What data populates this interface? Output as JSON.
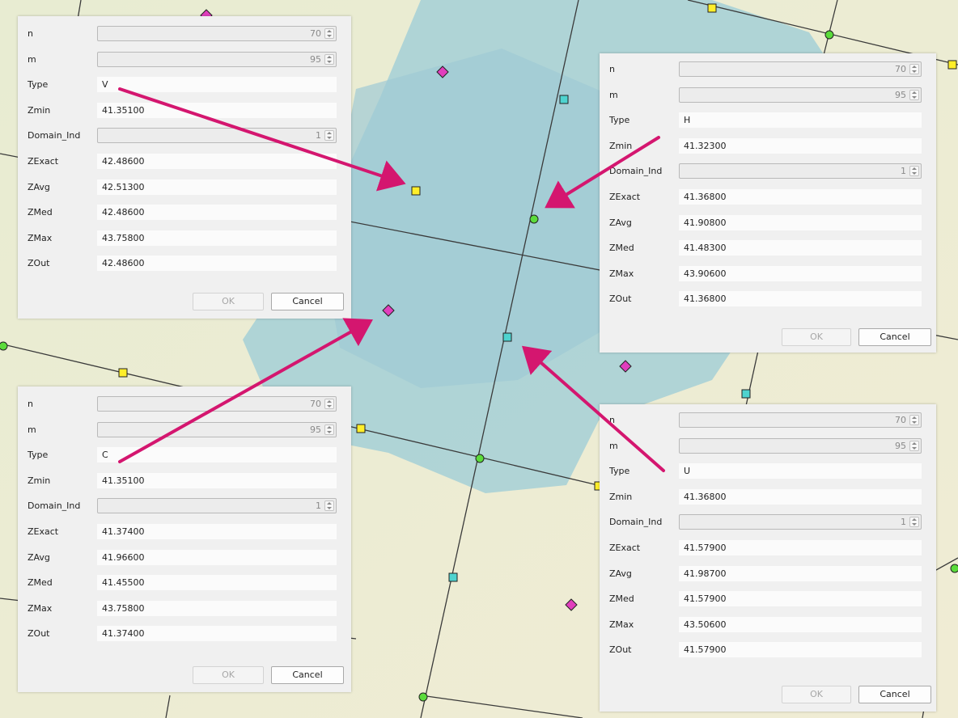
{
  "colors": {
    "arrow": "#d4166f",
    "node_green": "#5bdb3b",
    "node_yellow": "#ffee2a",
    "node_cyan": "#4ed3cf",
    "node_magenta": "#e13fbd",
    "water": "#a9d2d6",
    "land": "#e9ecd6"
  },
  "icons": {
    "spinbox": "spinbox-arrows-icon",
    "arrow": "annotation-arrow-icon",
    "node_markers": [
      "green-circle-node",
      "yellow-square-node",
      "cyan-square-node",
      "magenta-diamond-node"
    ]
  },
  "dialogs": [
    {
      "id": "v",
      "fields": [
        {
          "label": "n",
          "value": "70",
          "kind": "spin"
        },
        {
          "label": "m",
          "value": "95",
          "kind": "spin"
        },
        {
          "label": "Type",
          "value": "V",
          "kind": "text"
        },
        {
          "label": "Zmin",
          "value": "41.35100",
          "kind": "text"
        },
        {
          "label": "Domain_Ind",
          "value": "1",
          "kind": "spin"
        },
        {
          "label": "ZExact",
          "value": "42.48600",
          "kind": "text"
        },
        {
          "label": "ZAvg",
          "value": "42.51300",
          "kind": "text"
        },
        {
          "label": "ZMed",
          "value": "42.48600",
          "kind": "text"
        },
        {
          "label": "ZMax",
          "value": "43.75800",
          "kind": "text"
        },
        {
          "label": "ZOut",
          "value": "42.48600",
          "kind": "text"
        }
      ],
      "ok_label": "OK",
      "cancel_label": "Cancel"
    },
    {
      "id": "h",
      "fields": [
        {
          "label": "n",
          "value": "70",
          "kind": "spin"
        },
        {
          "label": "m",
          "value": "95",
          "kind": "spin"
        },
        {
          "label": "Type",
          "value": "H",
          "kind": "text"
        },
        {
          "label": "Zmin",
          "value": "41.32300",
          "kind": "text"
        },
        {
          "label": "Domain_Ind",
          "value": "1",
          "kind": "spin"
        },
        {
          "label": "ZExact",
          "value": "41.36800",
          "kind": "text"
        },
        {
          "label": "ZAvg",
          "value": "41.90800",
          "kind": "text"
        },
        {
          "label": "ZMed",
          "value": "41.48300",
          "kind": "text"
        },
        {
          "label": "ZMax",
          "value": "43.90600",
          "kind": "text"
        },
        {
          "label": "ZOut",
          "value": "41.36800",
          "kind": "text"
        }
      ],
      "ok_label": "OK",
      "cancel_label": "Cancel"
    },
    {
      "id": "c",
      "fields": [
        {
          "label": "n",
          "value": "70",
          "kind": "spin"
        },
        {
          "label": "m",
          "value": "95",
          "kind": "spin"
        },
        {
          "label": "Type",
          "value": "C",
          "kind": "text"
        },
        {
          "label": "Zmin",
          "value": "41.35100",
          "kind": "text"
        },
        {
          "label": "Domain_Ind",
          "value": "1",
          "kind": "spin"
        },
        {
          "label": "ZExact",
          "value": "41.37400",
          "kind": "text"
        },
        {
          "label": "ZAvg",
          "value": "41.96600",
          "kind": "text"
        },
        {
          "label": "ZMed",
          "value": "41.45500",
          "kind": "text"
        },
        {
          "label": "ZMax",
          "value": "43.75800",
          "kind": "text"
        },
        {
          "label": "ZOut",
          "value": "41.37400",
          "kind": "text"
        }
      ],
      "ok_label": "OK",
      "cancel_label": "Cancel"
    },
    {
      "id": "u",
      "fields": [
        {
          "label": "n",
          "value": "70",
          "kind": "spin"
        },
        {
          "label": "m",
          "value": "95",
          "kind": "spin"
        },
        {
          "label": "Type",
          "value": "U",
          "kind": "text"
        },
        {
          "label": "Zmin",
          "value": "41.36800",
          "kind": "text"
        },
        {
          "label": "Domain_Ind",
          "value": "1",
          "kind": "spin"
        },
        {
          "label": "ZExact",
          "value": "41.57900",
          "kind": "text"
        },
        {
          "label": "ZAvg",
          "value": "41.98700",
          "kind": "text"
        },
        {
          "label": "ZMed",
          "value": "41.57900",
          "kind": "text"
        },
        {
          "label": "ZMax",
          "value": "43.50600",
          "kind": "text"
        },
        {
          "label": "ZOut",
          "value": "41.57900",
          "kind": "text"
        }
      ],
      "ok_label": "OK",
      "cancel_label": "Cancel"
    }
  ]
}
